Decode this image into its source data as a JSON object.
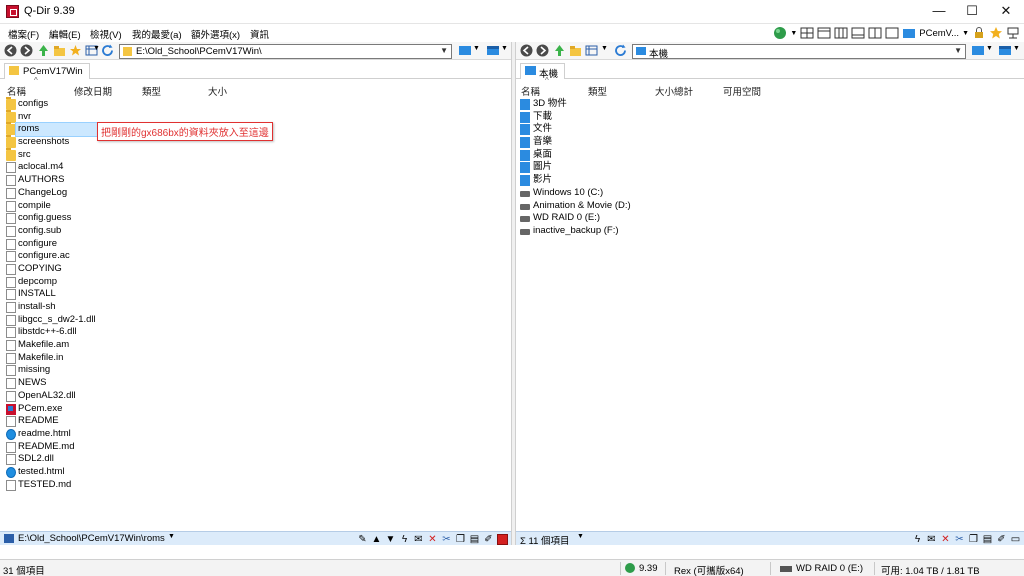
{
  "window": {
    "title": "Q-Dir 9.39"
  },
  "menu": [
    "檔案(F)",
    "編輯(E)",
    "檢視(V)",
    "我的最愛(a)",
    "額外選項(x)",
    "資訊"
  ],
  "toolbar": {
    "profile_label": "PCemV..."
  },
  "left_pane": {
    "address": "E:\\Old_School\\PCemV17Win\\",
    "tab": "PCemV17Win",
    "columns": [
      "名稱",
      "修改日期",
      "類型",
      "大小"
    ],
    "items": [
      {
        "name": "configs",
        "icon": "folder-icon"
      },
      {
        "name": "nvr",
        "icon": "folder-icon"
      },
      {
        "name": "roms",
        "icon": "folder-icon"
      },
      {
        "name": "screenshots",
        "icon": "folder-icon"
      },
      {
        "name": "src",
        "icon": "folder-icon"
      },
      {
        "name": "aclocal.m4",
        "icon": "file-icon"
      },
      {
        "name": "AUTHORS",
        "icon": "file-icon"
      },
      {
        "name": "ChangeLog",
        "icon": "file-icon"
      },
      {
        "name": "compile",
        "icon": "file-icon"
      },
      {
        "name": "config.guess",
        "icon": "file-icon"
      },
      {
        "name": "config.sub",
        "icon": "file-icon"
      },
      {
        "name": "configure",
        "icon": "file-icon"
      },
      {
        "name": "configure.ac",
        "icon": "file-icon"
      },
      {
        "name": "COPYING",
        "icon": "file-icon"
      },
      {
        "name": "depcomp",
        "icon": "file-icon"
      },
      {
        "name": "INSTALL",
        "icon": "file-icon"
      },
      {
        "name": "install-sh",
        "icon": "file-icon"
      },
      {
        "name": "libgcc_s_dw2-1.dll",
        "icon": "file-icon"
      },
      {
        "name": "libstdc++-6.dll",
        "icon": "file-icon"
      },
      {
        "name": "Makefile.am",
        "icon": "file-icon"
      },
      {
        "name": "Makefile.in",
        "icon": "file-icon"
      },
      {
        "name": "missing",
        "icon": "file-icon"
      },
      {
        "name": "NEWS",
        "icon": "file-icon"
      },
      {
        "name": "OpenAL32.dll",
        "icon": "file-icon"
      },
      {
        "name": "PCem.exe",
        "icon": "exe-icon"
      },
      {
        "name": "README",
        "icon": "file-icon"
      },
      {
        "name": "readme.html",
        "icon": "edge-icon"
      },
      {
        "name": "README.md",
        "icon": "file-icon"
      },
      {
        "name": "SDL2.dll",
        "icon": "file-icon"
      },
      {
        "name": "tested.html",
        "icon": "edge-icon"
      },
      {
        "name": "TESTED.md",
        "icon": "file-icon"
      }
    ],
    "tooltip": "把剛剛的gx686bx的資料夾放入至這邊",
    "status_path": "E:\\Old_School\\PCemV17Win\\roms"
  },
  "right_pane": {
    "address": "本機",
    "tab": "本機",
    "columns": [
      "名稱",
      "類型",
      "大小總計",
      "可用空間"
    ],
    "items": [
      {
        "name": "3D 物件",
        "icon": "3d-objects-icon"
      },
      {
        "name": "下載",
        "icon": "download-icon"
      },
      {
        "name": "文件",
        "icon": "document-icon"
      },
      {
        "name": "音樂",
        "icon": "music-icon"
      },
      {
        "name": "桌面",
        "icon": "desktop-icon"
      },
      {
        "name": "圖片",
        "icon": "pictures-icon"
      },
      {
        "name": "影片",
        "icon": "video-icon"
      },
      {
        "name": "Windows 10 (C:)",
        "icon": "drive-icon"
      },
      {
        "name": "Animation & Movie (D:)",
        "icon": "drive-icon"
      },
      {
        "name": "WD RAID 0 (E:)",
        "icon": "drive-icon"
      },
      {
        "name": "inactive_backup (F:)",
        "icon": "drive-icon"
      }
    ],
    "status_count": "Σ 11 個項目"
  },
  "statusbar": {
    "items_count": "31 個項目",
    "version": "9.39",
    "edition": "Rex (可攜版x64)",
    "drive": "WD RAID 0 (E:)",
    "free_space": "可用: 1.04 TB / 1.81 TB"
  }
}
